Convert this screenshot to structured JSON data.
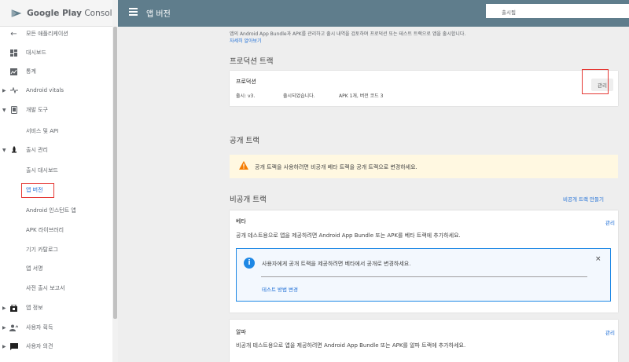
{
  "app": {
    "logo_primary": "Google Play",
    "logo_secondary": "Console"
  },
  "header": {
    "title": "앱 버전",
    "status_text": "출시됨"
  },
  "sidebar": {
    "items": [
      {
        "label": "모든 애플리케이션",
        "icon": "back-arrow-icon"
      },
      {
        "label": "대시보드",
        "icon": "dashboard-icon"
      },
      {
        "label": "통계",
        "icon": "stats-icon"
      },
      {
        "label": "Android vitals",
        "icon": "vitals-icon"
      },
      {
        "label": "개발 도구",
        "icon": "dev-tools-icon"
      },
      {
        "label": "서비스 및 API"
      },
      {
        "label": "출시 관리",
        "icon": "rocket-icon"
      },
      {
        "label": "출시 대시보드"
      },
      {
        "label": "앱 버전"
      },
      {
        "label": "Android 인스턴트 앱"
      },
      {
        "label": "APK 라이브러리"
      },
      {
        "label": "기기 카탈로그"
      },
      {
        "label": "앱 서명"
      },
      {
        "label": "사전 출시 보고서"
      },
      {
        "label": "앱 정보",
        "icon": "store-icon"
      },
      {
        "label": "사용자 획득",
        "icon": "user-acquisition-icon"
      },
      {
        "label": "사용자 의견",
        "icon": "feedback-icon"
      }
    ]
  },
  "main": {
    "intro_text": "앱의 Android App Bundle과 APK를 관리하고 출시 내역을 검토하며 프로덕션 또는 테스트 트랙으로 앱을 출시합니다.",
    "intro_link": "자세히 알아보기",
    "production": {
      "section_title": "프로덕션 트랙",
      "card_name": "프로덕션",
      "release_label": "출시: v3.",
      "release_status": "출시되었습니다.",
      "release_detail": "APK 1개, 버전 코드 3",
      "manage_label": "관리"
    },
    "open": {
      "section_title": "공개 트랙",
      "warning_text": "공개 트랙을 사용하려면 비공개 베타 트랙을 공개 트랙으로 변경하세요."
    },
    "closed": {
      "section_title": "비공개 트랙",
      "create_link": "비공개 트랙 만들기",
      "beta": {
        "name": "베타",
        "manage_label": "관리",
        "description": "공개 테스트용으로 앱을 제공하려면 Android App Bundle 또는 APK를 베타 트랙에 추가하세요.",
        "info_text": "사용자에게 공개 트랙을 제공하려면 베타에서 공개로 변경하세요.",
        "info_close": "×",
        "info_link": "테스트 방법 변경"
      },
      "alpha": {
        "name": "알파",
        "manage_label": "관리",
        "description": "비공개 테스트용으로 앱을 제공하려면 Android App Bundle 또는 APK를 알파 트랙에 추가하세요."
      }
    }
  },
  "colors": {
    "header": "#5f7d8c",
    "link": "#1e6ed6",
    "highlight": "#e53935",
    "warning": "#fff8e1",
    "info": "#1e88e5"
  }
}
